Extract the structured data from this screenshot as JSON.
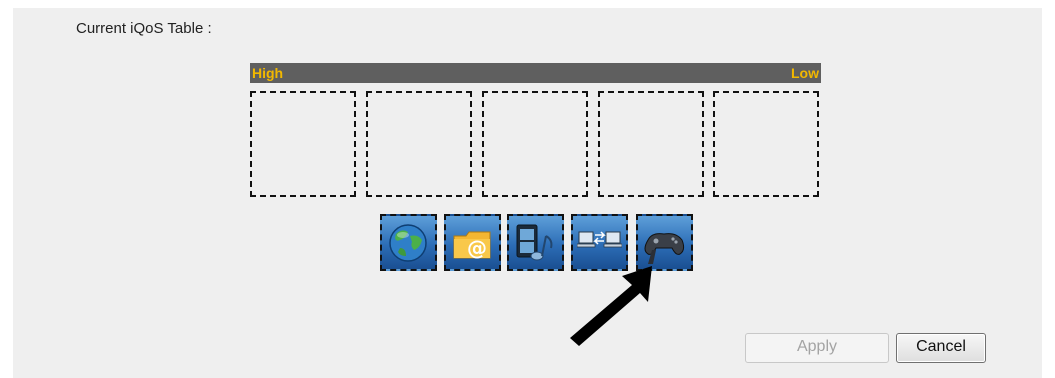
{
  "table": {
    "title": "Current iQoS Table :",
    "high_label": "High",
    "low_label": "Low"
  },
  "apps": [
    {
      "name": "web-browsing",
      "icon": "globe-icon"
    },
    {
      "name": "email",
      "icon": "email-folder-icon"
    },
    {
      "name": "media-streaming",
      "icon": "film-music-icon"
    },
    {
      "name": "file-transfer",
      "icon": "computers-transfer-icon"
    },
    {
      "name": "online-gaming",
      "icon": "gamepad-icon"
    }
  ],
  "buttons": {
    "apply_label": "Apply",
    "cancel_label": "Cancel"
  },
  "colors": {
    "panel_bg": "#efefef",
    "priority_bar_bg": "#5f5f5f",
    "priority_text": "#f2b800",
    "icon_blue": "#2c6db6"
  }
}
